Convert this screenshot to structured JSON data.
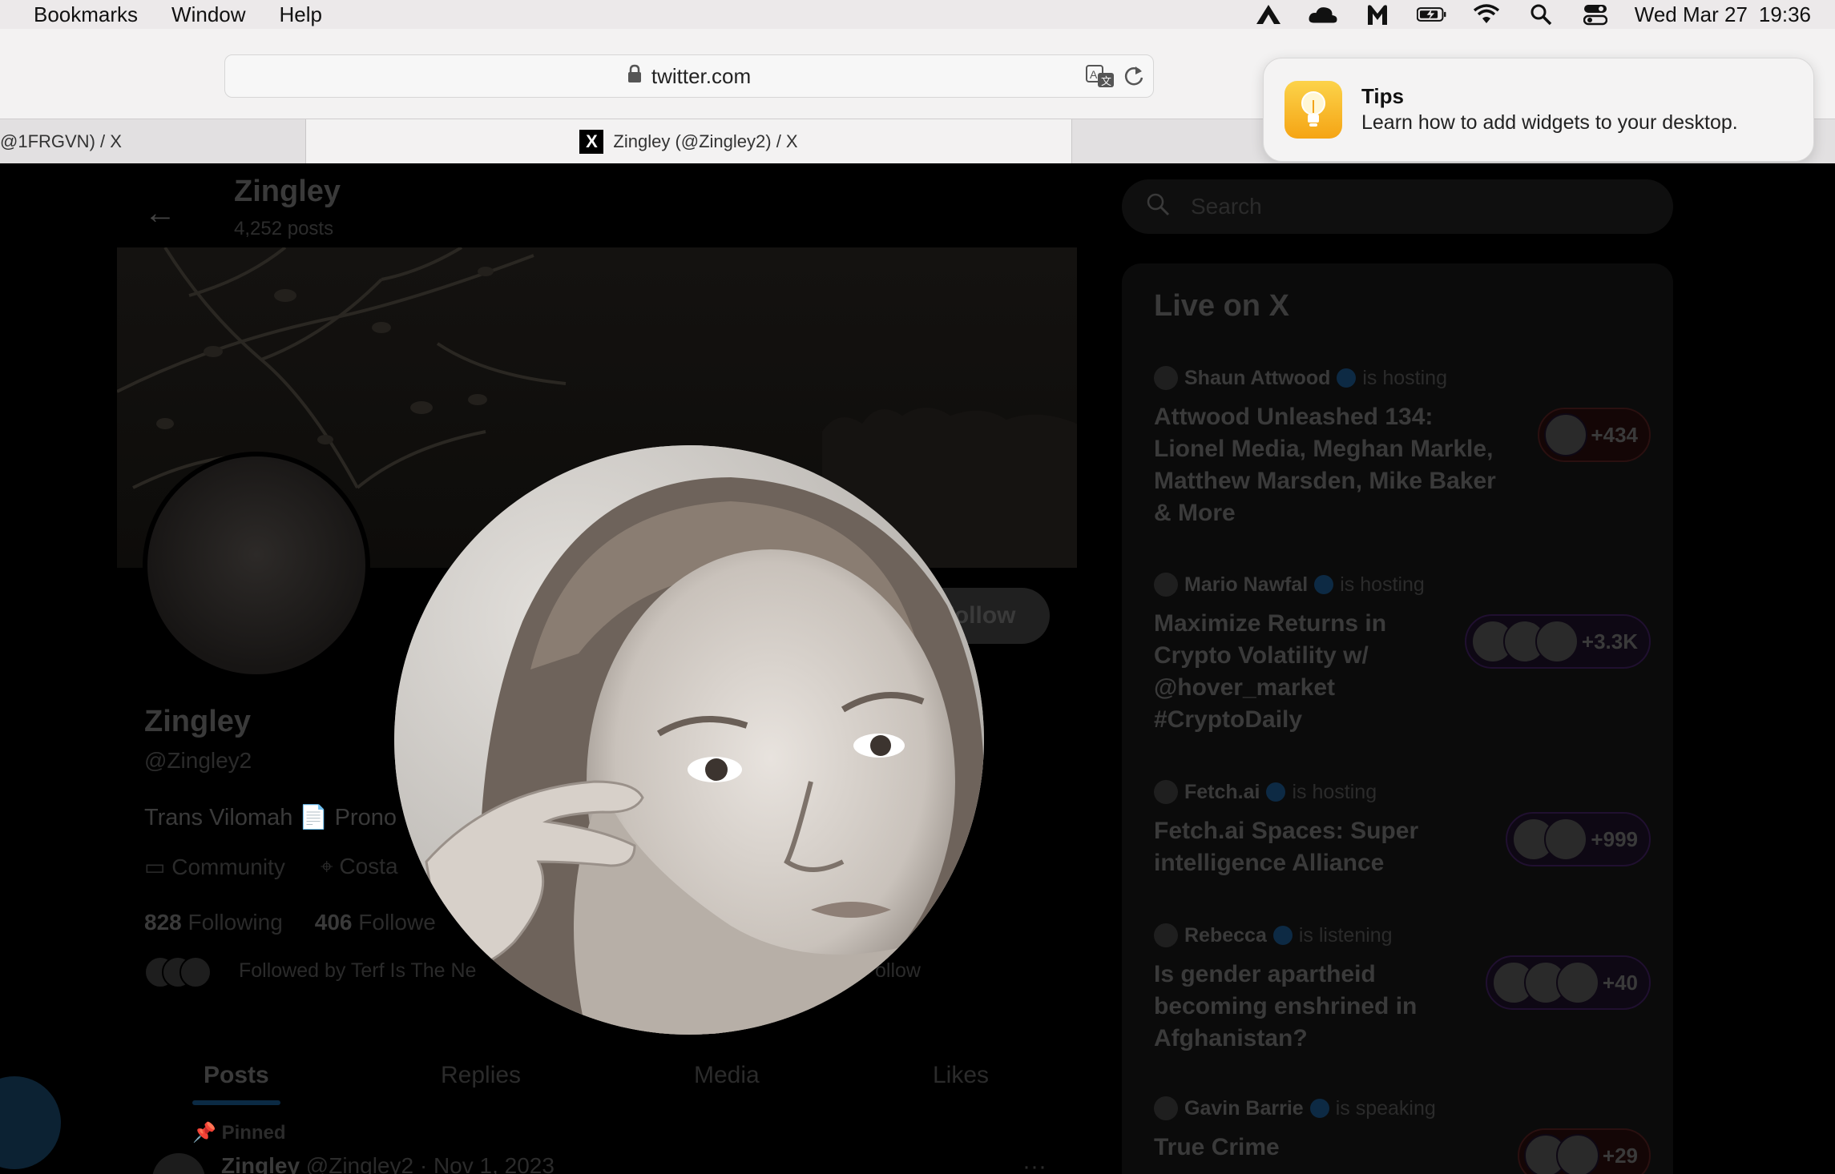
{
  "menubar": {
    "items": [
      "Bookmarks",
      "Window",
      "Help"
    ],
    "date": "Wed Mar 27",
    "time": "19:36"
  },
  "browser": {
    "url": "twitter.com",
    "tabs": [
      {
        "title": "@1FRGVN) / X",
        "active": false
      },
      {
        "title": "Zingley (@Zingley2) / X",
        "active": true
      }
    ]
  },
  "notification": {
    "title": "Tips",
    "body": "Learn how to add widgets to your desktop."
  },
  "profile": {
    "header_name": "Zingley",
    "post_count": "4,252 posts",
    "name": "Zingley",
    "handle": "@Zingley2",
    "bio": "Trans Vilomah 📄 Prono",
    "meta_community": "Community",
    "meta_location": "Costa",
    "following_count": "828",
    "following_label": "Following",
    "followers_count": "406",
    "followers_label": "Followe",
    "followed_by": "Followed by Terf Is The Ne",
    "followed_by_tail": "ollow",
    "follow_button": "Follow",
    "tabs": [
      "Posts",
      "Replies",
      "Media",
      "Likes"
    ],
    "pinned_label": "Pinned",
    "post_author": "Zingley",
    "post_meta": "@Zingley2 · Nov 1, 2023",
    "post_more": "···"
  },
  "sidebar": {
    "search_placeholder": "Search",
    "live_title": "Live on X",
    "spaces": [
      {
        "host": "Shaun Attwood",
        "status": "is hosting",
        "title": "Attwood Unleashed 134: Lionel Media, Meghan Markle, Matthew Marsden, Mike Baker & More",
        "count": "+434"
      },
      {
        "host": "Mario Nawfal",
        "status": "is hosting",
        "title": "Maximize Returns in Crypto Volatility w/ @hover_market #CryptoDaily",
        "count": "+3.3K"
      },
      {
        "host": "Fetch.ai",
        "status": "is hosting",
        "title": "Fetch.ai Spaces: Super intelligence Alliance",
        "count": "+999"
      },
      {
        "host": "Rebecca",
        "status": "is listening",
        "title": "Is gender apartheid becoming enshrined in Afghanistan?",
        "count": "+40"
      },
      {
        "host": "Gavin Barrie",
        "status": "is speaking",
        "title": "True Crime",
        "count": "+29"
      }
    ]
  },
  "colors": {
    "menubar_bg": "#ece9ea",
    "tips_icon": "#f5b42a",
    "page_bg": "#000000"
  }
}
